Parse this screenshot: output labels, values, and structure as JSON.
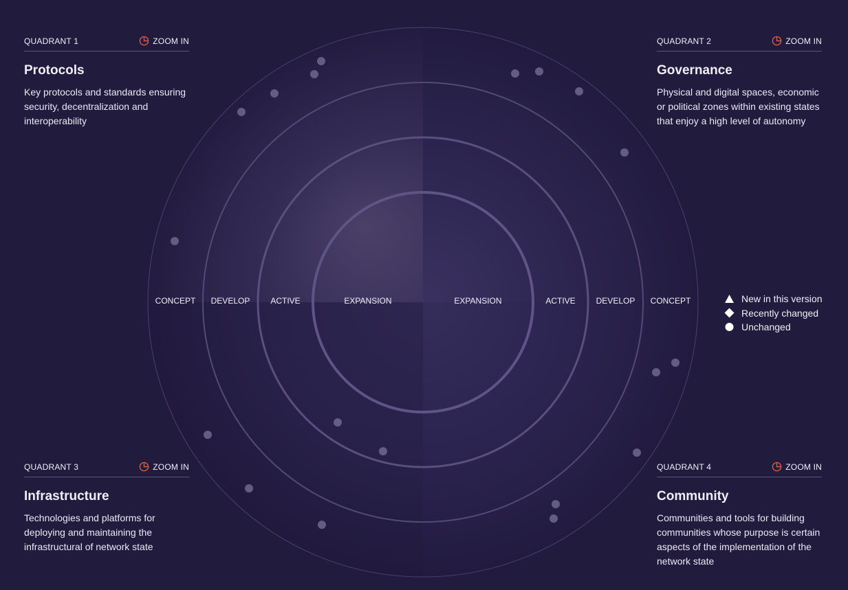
{
  "rings": [
    "EXPANSION",
    "ACTIVE",
    "DEVELOP",
    "CONCEPT"
  ],
  "quadrants": [
    {
      "label": "QUADRANT 1",
      "zoom": "ZOOM IN",
      "title": "Protocols",
      "description": "Key protocols and standards ensuring security, decentralization and interoperability"
    },
    {
      "label": "QUADRANT 2",
      "zoom": "ZOOM IN",
      "title": "Governance",
      "description": "Physical and digital spaces, economic or political zones within existing states that enjoy a high level of autonomy"
    },
    {
      "label": "QUADRANT 3",
      "zoom": "ZOOM IN",
      "title": "Infrastructure",
      "description": "Technologies and platforms for deploying and maintaining the infrastructural of network state"
    },
    {
      "label": "QUADRANT 4",
      "zoom": "ZOOM IN",
      "title": "Community",
      "description": "Communities and tools for building communities whose purpose is certain aspects of the implementation of the network state"
    }
  ],
  "legend": {
    "new": "New in this version",
    "changed": "Recently changed",
    "unchanged": "Unchanged"
  },
  "colors": {
    "background": "#211b3d",
    "accent": "#e2583b",
    "blip": "#6c6489",
    "text": "#f1eef8"
  },
  "icons": {
    "zoom": "pie-chart-icon",
    "new": "triangle-icon",
    "changed": "diamond-icon",
    "unchanged": "circle-icon"
  }
}
